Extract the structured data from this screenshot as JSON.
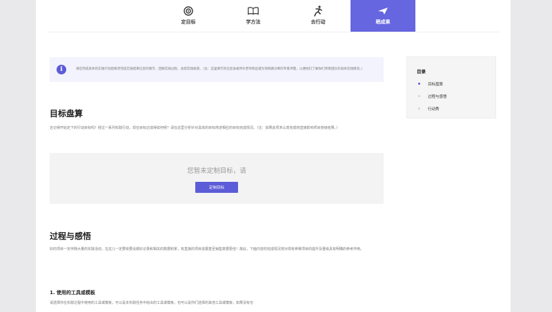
{
  "nav": {
    "steps": [
      {
        "label": "定目标",
        "icon": "target-icon",
        "active": false
      },
      {
        "label": "学方法",
        "icon": "book-icon",
        "active": false
      },
      {
        "label": "去行动",
        "icon": "runner-icon",
        "active": false
      },
      {
        "label": "晒成果",
        "icon": "paper-plane-icon",
        "active": true
      }
    ]
  },
  "notice": {
    "text": "请在完成具体的实践行动后要求完成实践结果信息的填写、回顾实践过程、总结实践收获。（注：这里填写的信息会被评价老师和出城为项目路诊断的专家评量，以便他们了解你们项目团队的具体实践情况。）"
  },
  "section1": {
    "title": "目标盘算",
    "desc": "还记得开始定下的行动目标吗？经过一系列实践行动，现在目标达成得如何呢？请在这里分析针对具体的目标简述相应的目标完成情况。（注：如果此项未认真完成将直接影响项目普级结果。）",
    "empty_text": "您暂未定制目标，请",
    "button": "定制目标"
  },
  "section2": {
    "title": "过程与感悟",
    "desc": "好的项目一定伴随大量的实践活动，在这儿一定要有要设做好记录和相关的数据积累，有直接的项目进展甚至销售数据更佳！故此，下面内容的完成情况将对现有参赛项目的提升及晋级具有明确的参考作用。",
    "sub_title": "1.   使用的工具或模板",
    "sub_desc": "请选择你在实践过程中使用的工具或模板，可以是本实践任务中给出的工具或模板，也可以是你们选择的其他工具或模板，如果没有也"
  },
  "toc": {
    "title": "目录",
    "items": [
      {
        "label": "目标盘算",
        "active": true
      },
      {
        "label": "过程与感悟",
        "active": false
      },
      {
        "label": "行动秀",
        "active": false
      }
    ]
  },
  "colors": {
    "accent": "#5c5cd8",
    "notice_bg": "#f3f3fd"
  }
}
